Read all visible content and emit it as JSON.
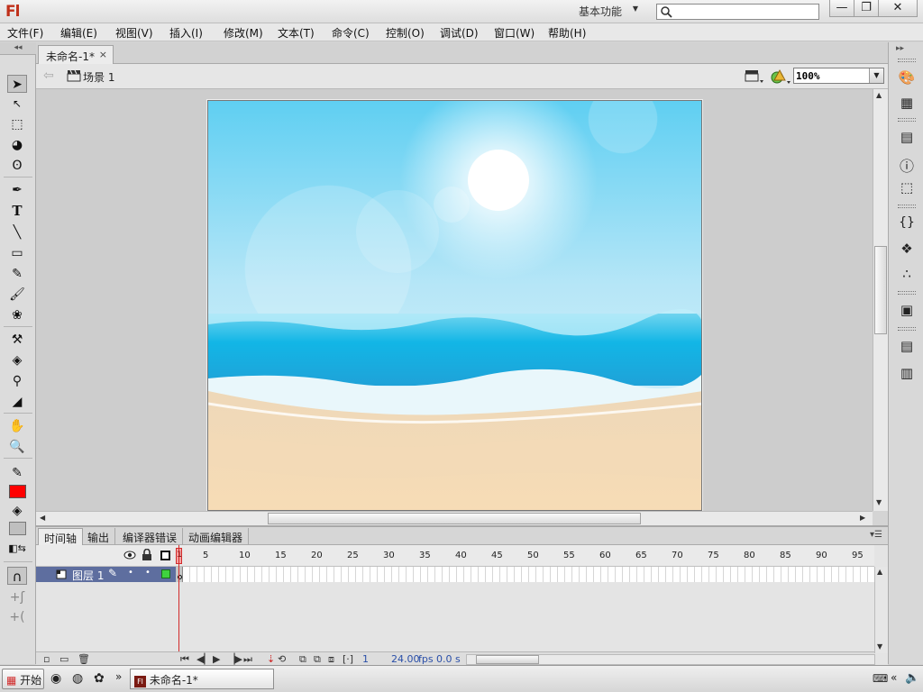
{
  "app": {
    "logo": "Fl",
    "workspace": "基本功能"
  },
  "search": {
    "placeholder": ""
  },
  "window_controls": {
    "minimize": "—",
    "restore": "❐",
    "close": "✕"
  },
  "menu": [
    "文件(F)",
    "编辑(E)",
    "视图(V)",
    "插入(I)",
    "修改(M)",
    "文本(T)",
    "命令(C)",
    "控制(O)",
    "调试(D)",
    "窗口(W)",
    "帮助(H)"
  ],
  "document": {
    "tab_title": "未命名-1*",
    "tab_close": "×",
    "scene": "场景 1",
    "zoom": "100%"
  },
  "timeline": {
    "tabs": [
      "时间轴",
      "输出",
      "编译器错误",
      "动画编辑器"
    ],
    "frame_numbers": [
      "1",
      "5",
      "10",
      "15",
      "20",
      "25",
      "30",
      "35",
      "40",
      "45",
      "50",
      "55",
      "60",
      "65",
      "70",
      "75",
      "80",
      "85",
      "90",
      "95"
    ],
    "layer_name": "图层 1",
    "current_frame": "1",
    "fps": "24.00",
    "fps_unit": "fps",
    "time": "0.0 s"
  },
  "colors": {
    "stroke": "#000000",
    "fill": "#ff0000",
    "layer_outline": "#3fd23f"
  },
  "taskbar": {
    "start": "开始",
    "task_item": "未命名-1*"
  }
}
